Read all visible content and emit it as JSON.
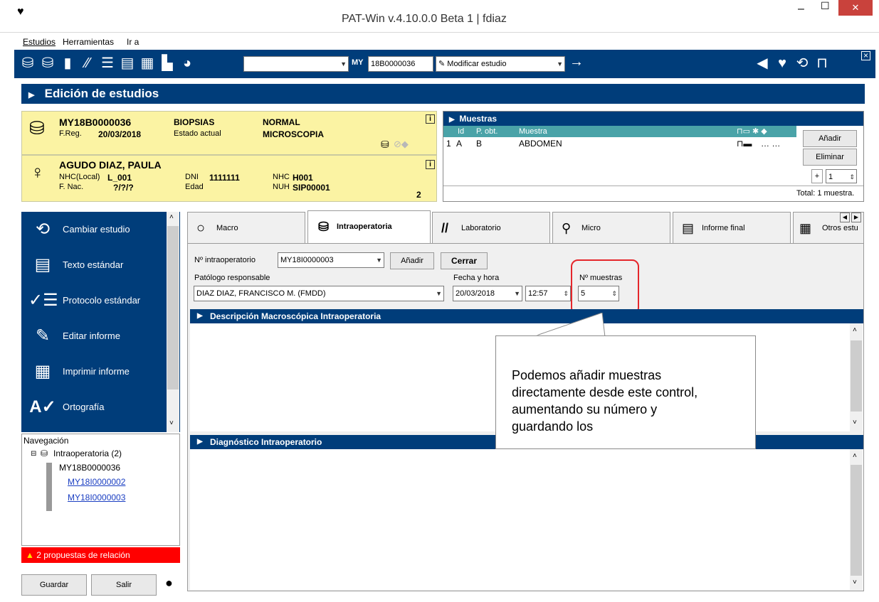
{
  "window": {
    "title": "PAT-Win v.4.10.0.0 Beta 1 | fdiaz",
    "minimize_label": "–",
    "maximize_label": "☐",
    "close_label": "✕"
  },
  "menu": {
    "items": [
      {
        "label": "Estudios"
      },
      {
        "label": "Herramientas"
      },
      {
        "label": "Ir a"
      }
    ]
  },
  "toolbar": {
    "search_value": "",
    "prefix_label": "MY",
    "study_code_value": "18B0000036",
    "action_value": "Modificar estudio",
    "go_label": "→"
  },
  "page": {
    "title": "Edición de estudios"
  },
  "study": {
    "code": "MY18B0000036",
    "type": "BIOPSIAS",
    "priority": "NORMAL",
    "freg_label": "F.Reg.",
    "freg_value": "20/03/2018",
    "state_label": "Estado actual",
    "state_value": "MICROSCOPIA",
    "info_label": "i"
  },
  "patient": {
    "name": "AGUDO DIAZ, PAULA",
    "nhc_local_label": "NHC(Local)",
    "nhc_local_value": "L_001",
    "dni_label": "DNI",
    "dni_value": "1111111",
    "nhc_label": "NHC",
    "nhc_value": "H001",
    "fnac_label": "F. Nac.",
    "fnac_value": "?/?/?",
    "edad_label": "Edad",
    "nuh_label": "NUH",
    "nuh_value": "SIP00001",
    "count": "2",
    "info_label": "i"
  },
  "samples": {
    "title": "Muestras",
    "columns": [
      "Id",
      "P. obt.",
      "Muestra"
    ],
    "rows": [
      {
        "num": "1",
        "id": "A",
        "pobt": "B",
        "muestra": "ABDOMEN",
        "extra": "… …"
      }
    ],
    "add_label": "Añadir",
    "delete_label": "Eliminar",
    "plus_label": "+",
    "spinner_value": "1",
    "total_label": "Total: 1 muestra."
  },
  "sidebar": {
    "items": [
      {
        "label": "Cambiar estudio"
      },
      {
        "label": "Texto estándar"
      },
      {
        "label": "Protocolo estándar"
      },
      {
        "label": "Editar informe"
      },
      {
        "label": "Imprimir informe"
      },
      {
        "label": "Ortografía"
      }
    ],
    "nav_title": "Navegación",
    "nav_root": "Intraoperatoria (2)",
    "nav_study": "MY18B0000036",
    "nav_links": [
      "MY18I0000002",
      "MY18I0000003"
    ],
    "warning": "2 propuestas de relación",
    "save_label": "Guardar",
    "exit_label": "Salir"
  },
  "tabs": [
    {
      "label": "Macro"
    },
    {
      "label": "Intraoperatoria"
    },
    {
      "label": "Laboratorio"
    },
    {
      "label": "Micro"
    },
    {
      "label": "Informe final"
    },
    {
      "label": "Otros estu"
    }
  ],
  "intraop": {
    "num_label": "Nº intraoperatorio",
    "num_value": "MY18I0000003",
    "add_label": "Añadir",
    "close_label": "Cerrar",
    "pathologist_label": "Patólogo responsable",
    "pathologist_value": "DIAZ DIAZ, FRANCISCO M.  (FMDD)",
    "date_label": "Fecha y hora",
    "date_value": "20/03/2018",
    "time_value": "12:57",
    "samples_label": "Nº muestras",
    "samples_value": "5",
    "macro_section": "Descripción Macroscópica Intraoperatoria",
    "diag_section": "Diagnóstico Intraoperatorio"
  },
  "callout": {
    "text": "Podemos añadir muestras directamente desde este control, aumentando su número y guardando los"
  },
  "colors": {
    "navy": "#003d7a",
    "yellow": "#fbf3a3",
    "teal": "#4aa3a8",
    "highlight": "#e5262b",
    "warning": "#ff0000"
  }
}
